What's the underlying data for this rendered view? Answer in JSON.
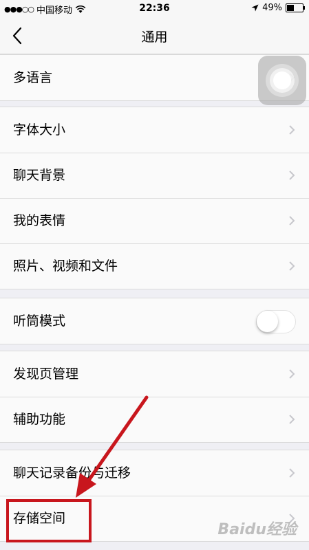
{
  "status_bar": {
    "carrier": "中国移动",
    "time": "22:36",
    "battery_percent": "49%",
    "signal_icon": "signal-dots-icon",
    "wifi_icon": "wifi-icon",
    "location_icon": "location-arrow-icon",
    "battery_level": 0.49
  },
  "navbar": {
    "title": "通用",
    "back_icon": "chevron-left-icon"
  },
  "groups": [
    {
      "items": [
        {
          "label": "多语言"
        }
      ]
    },
    {
      "items": [
        {
          "label": "字体大小"
        },
        {
          "label": "聊天背景"
        },
        {
          "label": "我的表情"
        },
        {
          "label": "照片、视频和文件"
        }
      ]
    },
    {
      "items": [
        {
          "label": "听筒模式",
          "toggle": false
        }
      ]
    },
    {
      "items": [
        {
          "label": "发现页管理"
        },
        {
          "label": "辅助功能"
        }
      ]
    },
    {
      "items": [
        {
          "label": "聊天记录备份与迁移"
        },
        {
          "label": "存储空间"
        }
      ]
    }
  ],
  "annotation": {
    "color": "#c8161d",
    "highlight_target": "存储空间"
  },
  "watermark": {
    "text": "Baidu经验"
  }
}
